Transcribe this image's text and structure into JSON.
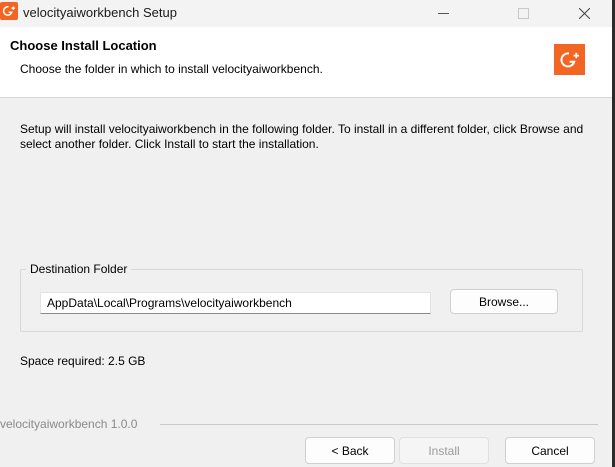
{
  "window": {
    "title": "velocityaiworkbench Setup",
    "accent_color": "#f26522",
    "icon": "app-logo-icon"
  },
  "header": {
    "title": "Choose Install Location",
    "subtitle": "Choose the folder in which to install velocityaiworkbench."
  },
  "body": {
    "intro": "Setup will install velocityaiworkbench in the following folder. To install in a different folder, click Browse and select another folder. Click Install to start the installation.",
    "destination_group_label": "Destination Folder",
    "destination_path": "AppData\\Local\\Programs\\velocityaiworkbench",
    "browse_label": "Browse...",
    "space_required": "Space required: 2.5 GB"
  },
  "footer": {
    "brand": "velocityaiworkbench 1.0.0",
    "back_label": "< Back",
    "install_label": "Install",
    "cancel_label": "Cancel"
  }
}
